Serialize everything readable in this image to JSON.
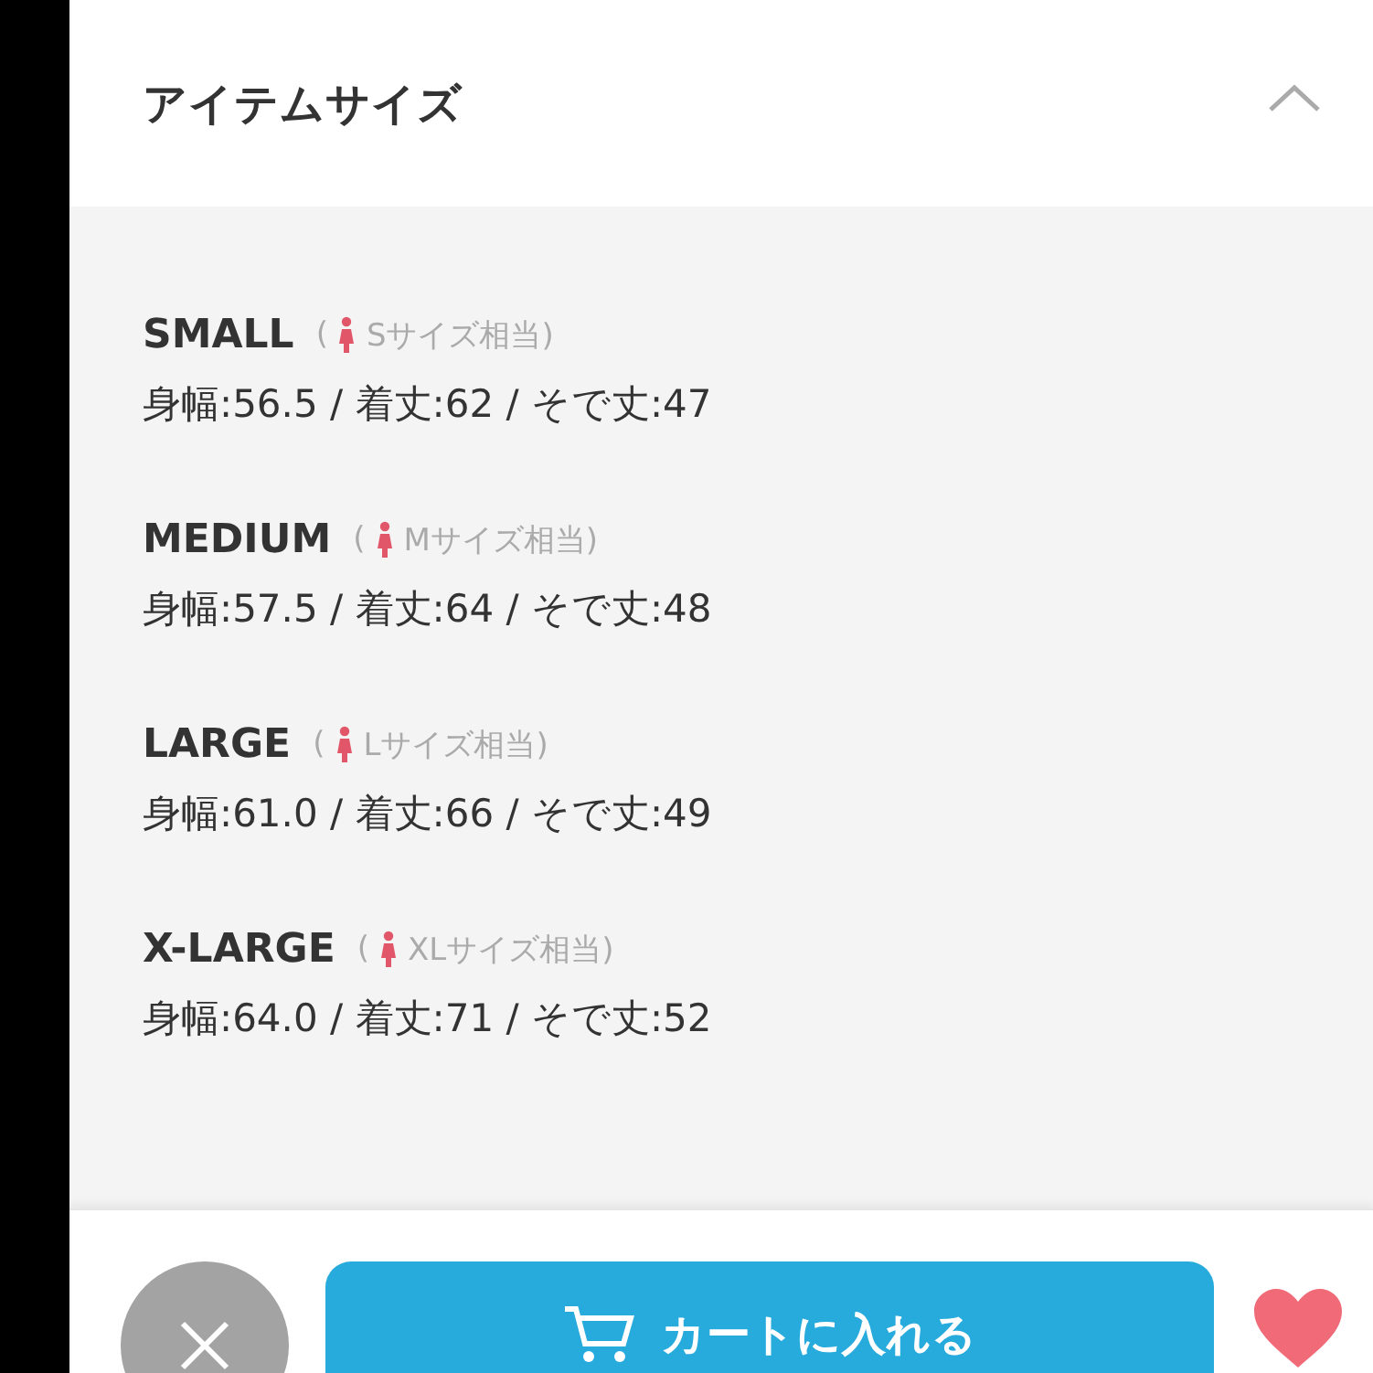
{
  "section": {
    "title": "アイテムサイズ",
    "expanded": true
  },
  "sizes": [
    {
      "name": "SMALL",
      "paren": "(",
      "equivalent": "Sサイズ相当)",
      "measurements": "身幅:56.5 / 着丈:62 / そで丈:47"
    },
    {
      "name": "MEDIUM",
      "paren": "(",
      "equivalent": "Mサイズ相当)",
      "measurements": "身幅:57.5 / 着丈:64 / そで丈:48"
    },
    {
      "name": "LARGE",
      "paren": "(",
      "equivalent": "Lサイズ相当)",
      "measurements": "身幅:61.0 / 着丈:66 / そで丈:49"
    },
    {
      "name": "X-LARGE",
      "paren": "(",
      "equivalent": "XLサイズ相当)",
      "measurements": "身幅:64.0 / 着丈:71 / そで丈:52"
    }
  ],
  "cart_button": {
    "label": "カートに入れる"
  }
}
